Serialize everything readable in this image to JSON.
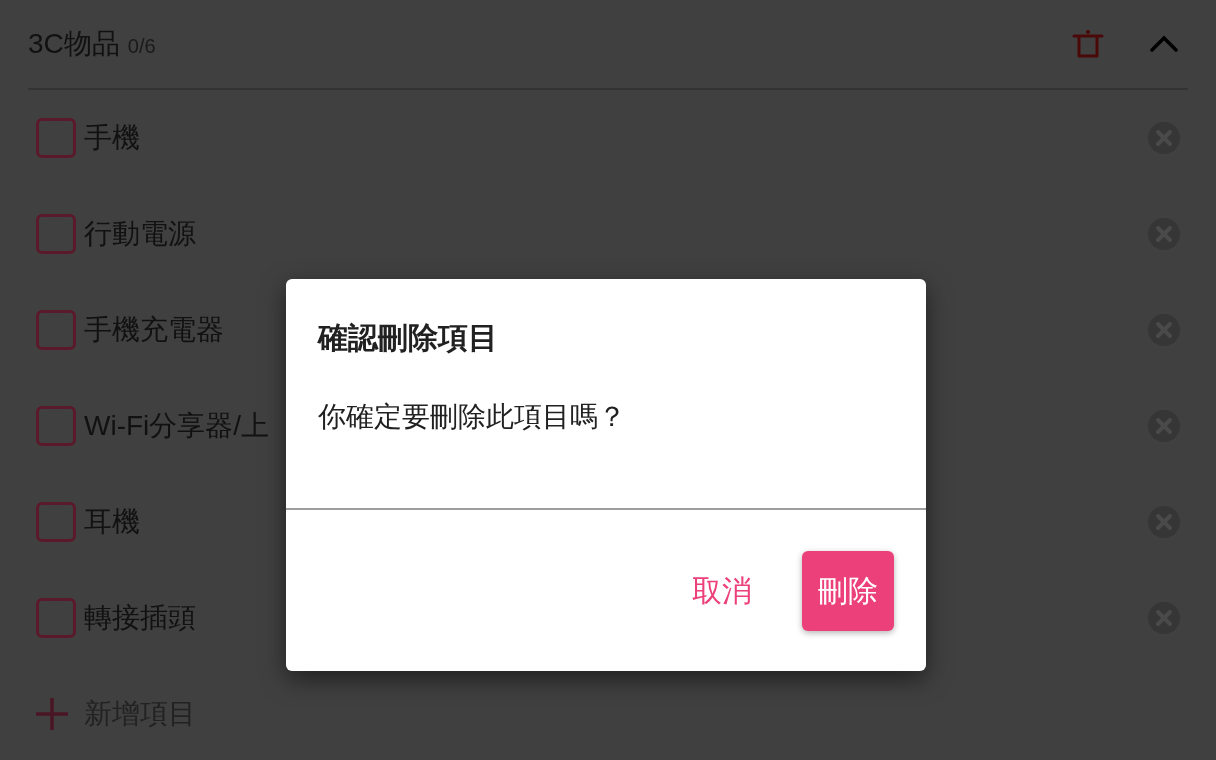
{
  "category": {
    "title": "3C物品",
    "count": "0/6",
    "expanded": true
  },
  "items": [
    {
      "label": "手機",
      "checked": false
    },
    {
      "label": "行動電源",
      "checked": false
    },
    {
      "label": "手機充電器",
      "checked": false
    },
    {
      "label": "Wi-Fi分享器/上",
      "checked": false
    },
    {
      "label": "耳機",
      "checked": false
    },
    {
      "label": "轉接插頭",
      "checked": false
    }
  ],
  "add_item": {
    "label": "新增項目"
  },
  "dialog": {
    "title": "確認刪除項目",
    "message": "你確定要刪除此項目嗎？",
    "buttons": [
      {
        "label": "取消",
        "kind": "text"
      },
      {
        "label": "刪除",
        "kind": "filled"
      }
    ]
  }
}
